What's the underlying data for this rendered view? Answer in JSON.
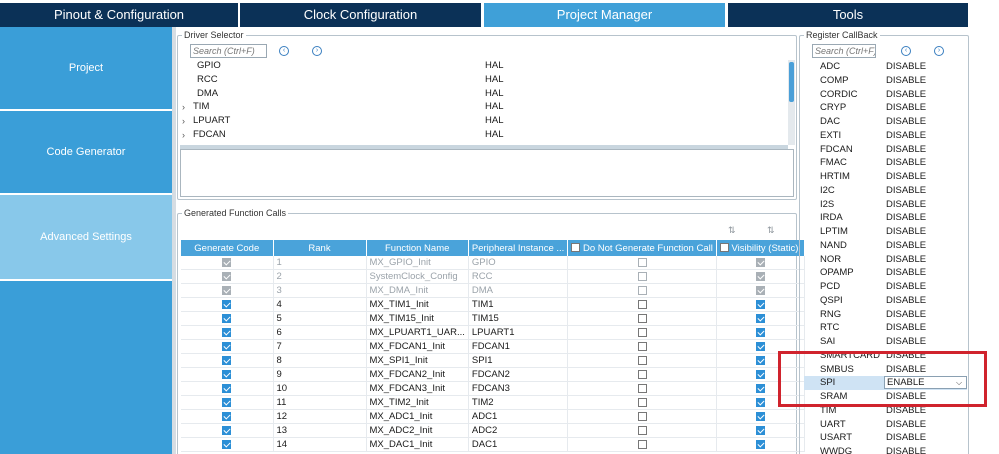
{
  "tabs": [
    "Pinout & Configuration",
    "Clock Configuration",
    "Project Manager",
    "Tools"
  ],
  "nav": [
    "Project",
    "Code Generator",
    "Advanced Settings"
  ],
  "driver_selector": {
    "legend": "Driver Selector",
    "search_placeholder": "Search (Ctrl+F)",
    "rows": [
      {
        "name": "GPIO",
        "lib": "HAL",
        "expand": false
      },
      {
        "name": "RCC",
        "lib": "HAL",
        "expand": false
      },
      {
        "name": "DMA",
        "lib": "HAL",
        "expand": false
      },
      {
        "name": "TIM",
        "lib": "HAL",
        "expand": true
      },
      {
        "name": "LPUART",
        "lib": "HAL",
        "expand": true
      },
      {
        "name": "FDCAN",
        "lib": "HAL",
        "expand": true
      }
    ]
  },
  "generated_calls": {
    "legend": "Generated Function Calls",
    "headers": [
      "Generate Code",
      "Rank",
      "Function Name",
      "Peripheral Instance ...",
      "Do Not Generate Function Call",
      "Visibility (Static)"
    ],
    "rows": [
      {
        "gen": true,
        "rank": "1",
        "fn": "MX_GPIO_Init",
        "inst": "GPIO",
        "nogen": false,
        "vis": true,
        "disabled": true
      },
      {
        "gen": true,
        "rank": "2",
        "fn": "SystemClock_Config",
        "inst": "RCC",
        "nogen": false,
        "vis": true,
        "disabled": true
      },
      {
        "gen": true,
        "rank": "3",
        "fn": "MX_DMA_Init",
        "inst": "DMA",
        "nogen": false,
        "vis": true,
        "disabled": true
      },
      {
        "gen": true,
        "rank": "4",
        "fn": "MX_TIM1_Init",
        "inst": "TIM1",
        "nogen": false,
        "vis": true,
        "disabled": false
      },
      {
        "gen": true,
        "rank": "5",
        "fn": "MX_TIM15_Init",
        "inst": "TIM15",
        "nogen": false,
        "vis": true,
        "disabled": false
      },
      {
        "gen": true,
        "rank": "6",
        "fn": "MX_LPUART1_UAR...",
        "inst": "LPUART1",
        "nogen": false,
        "vis": true,
        "disabled": false
      },
      {
        "gen": true,
        "rank": "7",
        "fn": "MX_FDCAN1_Init",
        "inst": "FDCAN1",
        "nogen": false,
        "vis": true,
        "disabled": false
      },
      {
        "gen": true,
        "rank": "8",
        "fn": "MX_SPI1_Init",
        "inst": "SPI1",
        "nogen": false,
        "vis": true,
        "disabled": false
      },
      {
        "gen": true,
        "rank": "9",
        "fn": "MX_FDCAN2_Init",
        "inst": "FDCAN2",
        "nogen": false,
        "vis": true,
        "disabled": false
      },
      {
        "gen": true,
        "rank": "10",
        "fn": "MX_FDCAN3_Init",
        "inst": "FDCAN3",
        "nogen": false,
        "vis": true,
        "disabled": false
      },
      {
        "gen": true,
        "rank": "11",
        "fn": "MX_TIM2_Init",
        "inst": "TIM2",
        "nogen": false,
        "vis": true,
        "disabled": false
      },
      {
        "gen": true,
        "rank": "12",
        "fn": "MX_ADC1_Init",
        "inst": "ADC1",
        "nogen": false,
        "vis": true,
        "disabled": false
      },
      {
        "gen": true,
        "rank": "13",
        "fn": "MX_ADC2_Init",
        "inst": "ADC2",
        "nogen": false,
        "vis": true,
        "disabled": false
      },
      {
        "gen": true,
        "rank": "14",
        "fn": "MX_DAC1_Init",
        "inst": "DAC1",
        "nogen": false,
        "vis": true,
        "disabled": false
      }
    ]
  },
  "register_callback": {
    "legend": "Register CallBack",
    "search_placeholder": "Search (Ctrl+F)",
    "items": [
      {
        "name": "ADC",
        "state": "DISABLE"
      },
      {
        "name": "COMP",
        "state": "DISABLE"
      },
      {
        "name": "CORDIC",
        "state": "DISABLE"
      },
      {
        "name": "CRYP",
        "state": "DISABLE"
      },
      {
        "name": "DAC",
        "state": "DISABLE"
      },
      {
        "name": "EXTI",
        "state": "DISABLE"
      },
      {
        "name": "FDCAN",
        "state": "DISABLE"
      },
      {
        "name": "FMAC",
        "state": "DISABLE"
      },
      {
        "name": "HRTIM",
        "state": "DISABLE"
      },
      {
        "name": "I2C",
        "state": "DISABLE"
      },
      {
        "name": "I2S",
        "state": "DISABLE"
      },
      {
        "name": "IRDA",
        "state": "DISABLE"
      },
      {
        "name": "LPTIM",
        "state": "DISABLE"
      },
      {
        "name": "NAND",
        "state": "DISABLE"
      },
      {
        "name": "NOR",
        "state": "DISABLE"
      },
      {
        "name": "OPAMP",
        "state": "DISABLE"
      },
      {
        "name": "PCD",
        "state": "DISABLE"
      },
      {
        "name": "QSPI",
        "state": "DISABLE"
      },
      {
        "name": "RNG",
        "state": "DISABLE"
      },
      {
        "name": "RTC",
        "state": "DISABLE"
      },
      {
        "name": "SAI",
        "state": "DISABLE"
      },
      {
        "name": "SMARTCARD",
        "state": "DISABLE"
      },
      {
        "name": "SMBUS",
        "state": "DISABLE"
      },
      {
        "name": "SPI",
        "state": "ENABLE",
        "selected": true
      },
      {
        "name": "SRAM",
        "state": "DISABLE"
      },
      {
        "name": "TIM",
        "state": "DISABLE"
      },
      {
        "name": "UART",
        "state": "DISABLE"
      },
      {
        "name": "USART",
        "state": "DISABLE"
      },
      {
        "name": "WWDG",
        "state": "DISABLE"
      }
    ]
  },
  "colors": {
    "tab_dark": "#0b3157",
    "tab_active": "#3fa0d8",
    "nav_blue": "#3a9ed8",
    "nav_selected": "#88c8ea",
    "highlight_box": "#d0232d",
    "check_blue": "#2c8fd6"
  }
}
